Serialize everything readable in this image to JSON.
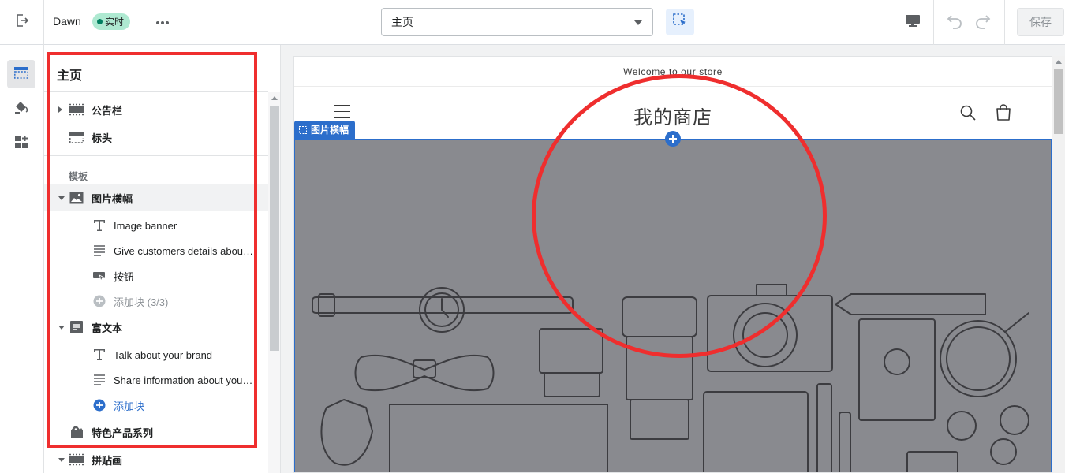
{
  "topbar": {
    "exit_icon": "exit-icon",
    "theme_name": "Dawn",
    "live_badge": "实时",
    "more_icon": "more-horizontal-icon",
    "page_select": {
      "value": "主页"
    },
    "inspector_icon": "select-element-icon",
    "device_icon": "desktop-icon",
    "undo_icon": "undo-icon",
    "redo_icon": "redo-icon",
    "save_label": "保存"
  },
  "rail": [
    {
      "icon": "sections-icon",
      "active": true
    },
    {
      "icon": "theme-settings-icon",
      "active": false
    },
    {
      "icon": "app-embeds-icon",
      "active": false
    }
  ],
  "panel": {
    "title": "主页",
    "header_sections": [
      {
        "label": "公告栏",
        "icon": "announcement-bar-icon",
        "expandable": true
      },
      {
        "label": "标头",
        "icon": "header-icon",
        "expandable": false
      }
    ],
    "template_label": "模板",
    "template_sections": [
      {
        "label": "图片横幅",
        "icon": "image-icon",
        "expanded": true,
        "selected": true,
        "blocks": [
          {
            "label": "Image banner",
            "icon": "text-icon"
          },
          {
            "label": "Give customers details about the banner image(s) or content on the template.",
            "icon": "paragraph-icon"
          },
          {
            "label": "按钮",
            "icon": "button-icon"
          }
        ],
        "add_block": "添加块 (3/3)",
        "add_disabled": true
      },
      {
        "label": "富文本",
        "icon": "rich-text-icon",
        "expanded": true,
        "blocks": [
          {
            "label": "Talk about your brand",
            "icon": "text-icon"
          },
          {
            "label": "Share information about your brand with your customers.",
            "icon": "paragraph-icon"
          }
        ],
        "add_block": "添加块",
        "add_disabled": false
      },
      {
        "label": "特色产品系列",
        "icon": "collection-icon"
      },
      {
        "label": "拼贴画",
        "icon": "collage-icon"
      }
    ]
  },
  "preview": {
    "announcement": "Welcome to our store",
    "store_name": "我的商店",
    "section_tag": "图片横幅",
    "menu_icon": "hamburger-icon",
    "search_icon": "search-icon",
    "cart_icon": "cart-icon",
    "banner_image": "product-illustration-image"
  },
  "colors": {
    "accent": "#2c6ecb",
    "live_badge_bg": "#aee9d1",
    "banner_bg": "#898a8f",
    "annotation_red": "#ef2e2e"
  }
}
